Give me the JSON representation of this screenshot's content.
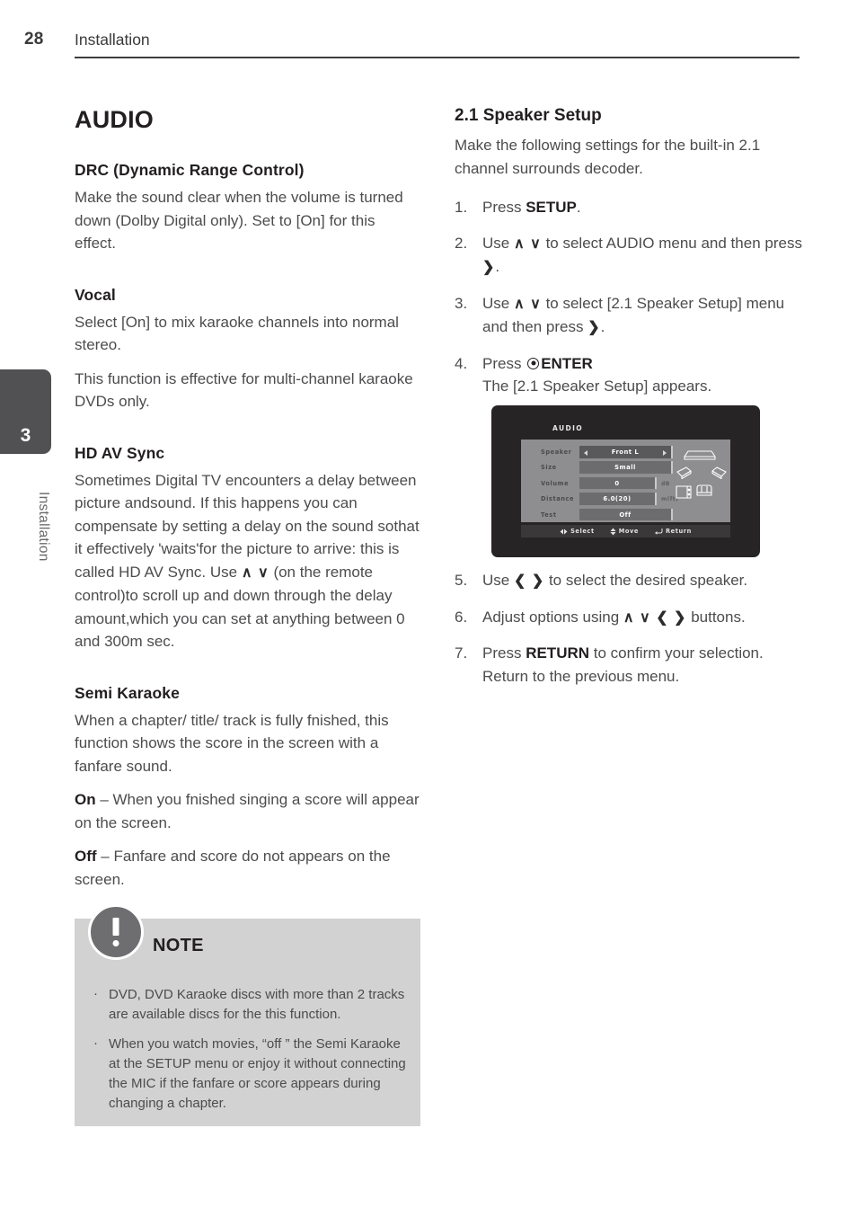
{
  "header": {
    "page_number": "28",
    "title": "Installation"
  },
  "side_tab": {
    "number": "3",
    "label": "Installation"
  },
  "left_column": {
    "audio_title": "AUDIO",
    "sections": [
      {
        "heading": "DRC (Dynamic Range Control)",
        "paragraphs": [
          "Make the sound clear when the volume is turned down (Dolby Digital only). Set to [On] for this effect."
        ]
      },
      {
        "heading": "Vocal",
        "paragraphs": [
          "Select [On] to mix karaoke channels into normal stereo.",
          "This function is effective for multi-channel karaoke DVDs only."
        ]
      },
      {
        "heading": "HD AV Sync",
        "paragraphs": [
          "Sometimes Digital TV encounters a delay between picture andsound. If this happens you can compensate by setting a delay on the sound sothat it effectively 'waits'for the picture to arrive: this is called HD AV Sync. Use",
          "(on the remote control)to scroll up and down through the delay amount,which you can set at anything between 0 and 300m sec."
        ],
        "arrows": "∧  ∨"
      },
      {
        "heading": "Semi Karaoke",
        "paragraphs": [
          "When a chapter/ title/ track is fully fnished, this function shows the score in the screen with a fanfare sound."
        ],
        "on_label": "On",
        "on_text": " – When you fnished singing a score will appear on the screen.",
        "off_label": "Off",
        "off_text": " – Fanfare and score do not appears on the screen."
      }
    ]
  },
  "note": {
    "title": "NOTE",
    "icon": "exclamation-icon",
    "items": [
      "DVD, DVD Karaoke discs with more than 2 tracks are available discs for the this function.",
      "When you watch movies, “off ” the Semi Karaoke at the SETUP menu or enjoy it without connecting the MIC if the fanfare or score appears during changing a chapter."
    ]
  },
  "right_column": {
    "heading": "2.1 Speaker Setup",
    "intro": "Make the following settings for the built-in 2.1 channel surrounds decoder.",
    "steps": [
      {
        "num": "1.",
        "pre": "Press ",
        "bold": "SETUP",
        "post": "."
      },
      {
        "num": "2.",
        "pre": "Use ",
        "arrows": "∧ ∨",
        "mid": " to select AUDIO menu and then press ",
        "arrow2": "❯",
        "post": "."
      },
      {
        "num": "3.",
        "pre": "Use ",
        "arrows": "∧ ∨",
        "mid": " to select [2.1 Speaker Setup] menu and then press ",
        "arrow2": "❯",
        "post": "."
      },
      {
        "num": "4.",
        "pre": "Press ",
        "bold": "ENTER",
        "post": "",
        "second_line": "The [2.1 Speaker Setup] appears."
      },
      {
        "num": "5.",
        "pre": "Use ",
        "arrows": "❮ ❯",
        "mid": " to select the desired speaker.",
        "post": ""
      },
      {
        "num": "6.",
        "pre": "Adjust options using ",
        "arrows": "∧ ∨ ❮ ❯",
        "mid": " buttons.",
        "post": ""
      },
      {
        "num": "7.",
        "pre": "Press ",
        "bold": "RETURN",
        "post": " to confirm your selection. Return to the previous menu."
      }
    ]
  },
  "osd_screenshot": {
    "title": "AUDIO",
    "rows": [
      {
        "label": "Speaker",
        "value": "Front L",
        "unit": "",
        "selected": true,
        "carets": true
      },
      {
        "label": "Size",
        "value": "Small",
        "unit": "",
        "selected": false,
        "carets": false
      },
      {
        "label": "Volume",
        "value": "0",
        "unit": "dB",
        "selected": false,
        "carets": false
      },
      {
        "label": "Distance",
        "value": "6.0(20)",
        "unit": "m(ft)",
        "selected": false,
        "carets": false
      },
      {
        "label": "Test",
        "value": "Off",
        "unit": "",
        "selected": false,
        "carets": false
      }
    ],
    "bottom_bar": [
      {
        "icon": "left-right-arrow-icon",
        "label": "Select"
      },
      {
        "icon": "up-down-arrow-icon",
        "label": "Move"
      },
      {
        "icon": "return-arrow-icon",
        "label": "Return"
      }
    ],
    "diagram_icons": [
      "tv-icon",
      "speaker-left-icon",
      "speaker-right-icon",
      "subwoofer-icon",
      "sofa-icon"
    ]
  },
  "colors": {
    "text_body": "#4c4c4e",
    "text_heading": "#231f20",
    "note_bg": "#d2d2d2",
    "tab_bg": "#515052",
    "osd_bg": "#272425"
  }
}
